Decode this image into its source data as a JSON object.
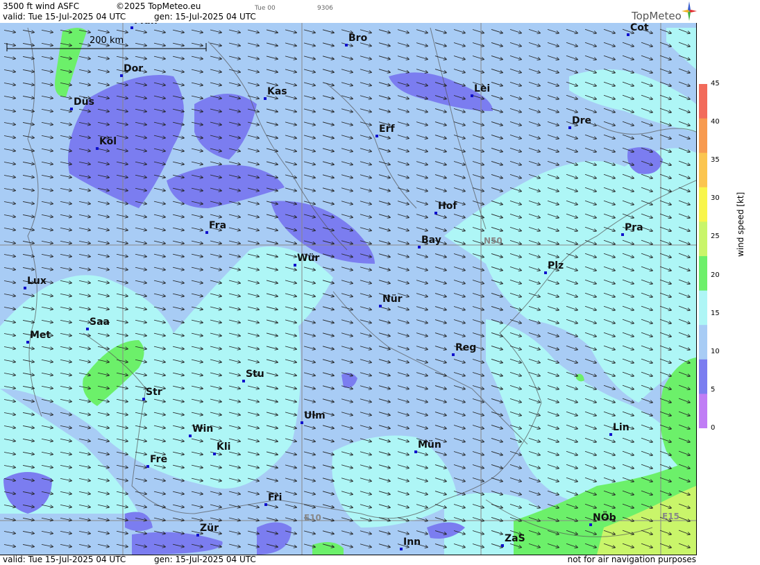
{
  "header": {
    "title": "3500 ft wind ASFC",
    "copyright": "©2025 TopMeteo.eu",
    "valid": "valid:  Tue  15-Jul-2025  04 UTC",
    "gen": "gen: 15-Jul-2025 04 UTC",
    "run_label": "Tue 00",
    "code": "9306",
    "logo": "TopMeteo"
  },
  "scale_bar": {
    "label": "200 km"
  },
  "grid_labels": {
    "n50": "N50",
    "e10": "E10",
    "e15": "E15"
  },
  "cities": [
    {
      "name": "Mün",
      "abbr": "Mün"
    },
    {
      "name": "Dor",
      "abbr": "Dor"
    },
    {
      "name": "Düs",
      "abbr": "Düs"
    },
    {
      "name": "Köl",
      "abbr": "Köl"
    },
    {
      "name": "Kas",
      "abbr": "Kas"
    },
    {
      "name": "Bro",
      "abbr": "Bro"
    },
    {
      "name": "Cot",
      "abbr": "Cot"
    },
    {
      "name": "Lei",
      "abbr": "Lei"
    },
    {
      "name": "Erf",
      "abbr": "Erf"
    },
    {
      "name": "Dre",
      "abbr": "Dre"
    },
    {
      "name": "Hof",
      "abbr": "Hof"
    },
    {
      "name": "Fra",
      "abbr": "Fra"
    },
    {
      "name": "Bay",
      "abbr": "Bay"
    },
    {
      "name": "Pra",
      "abbr": "Pra"
    },
    {
      "name": "Wür",
      "abbr": "Wür"
    },
    {
      "name": "Plz",
      "abbr": "Plz"
    },
    {
      "name": "Lux",
      "abbr": "Lux"
    },
    {
      "name": "Nür",
      "abbr": "Nür"
    },
    {
      "name": "Saa",
      "abbr": "Saa"
    },
    {
      "name": "Met",
      "abbr": "Met"
    },
    {
      "name": "Reg",
      "abbr": "Reg"
    },
    {
      "name": "Stu",
      "abbr": "Stu"
    },
    {
      "name": "Str",
      "abbr": "Str"
    },
    {
      "name": "Ulm",
      "abbr": "Ulm"
    },
    {
      "name": "Win",
      "abbr": "Win"
    },
    {
      "name": "Lin",
      "abbr": "Lin"
    },
    {
      "name": "Kli",
      "abbr": "Kli"
    },
    {
      "name": "Mün2",
      "abbr": "Mün"
    },
    {
      "name": "Fre",
      "abbr": "Fre"
    },
    {
      "name": "Fri",
      "abbr": "Fri"
    },
    {
      "name": "NÖb",
      "abbr": "NÖb"
    },
    {
      "name": "Zür",
      "abbr": "Zür"
    },
    {
      "name": "ZaS",
      "abbr": "ZaS"
    },
    {
      "name": "Inn",
      "abbr": "Inn"
    }
  ],
  "colorbar": {
    "label": "wind speed [kt]",
    "ticks": [
      "45",
      "40",
      "35",
      "30",
      "25",
      "20",
      "15",
      "10",
      "5",
      "0"
    ],
    "colors": [
      "#f26b5b",
      "#f79a4f",
      "#fbc54f",
      "#f8f54a",
      "#c9f56a",
      "#6cf06a",
      "#aef6f6",
      "#a8ccf5",
      "#7b7df0",
      "#c07df5"
    ]
  },
  "footer": {
    "valid": "valid:  Tue  15-Jul-2025  04 UTC",
    "gen": "gen: 15-Jul-2025 04 UTC",
    "disclaimer": "not for air navigation purposes"
  }
}
